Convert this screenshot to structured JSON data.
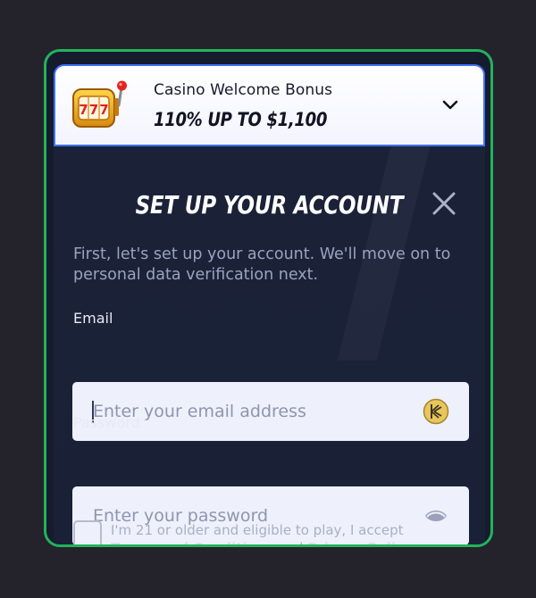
{
  "bonus": {
    "subtitle": "Casino Welcome Bonus",
    "title": "110% UP TO $1,100",
    "icon": "slot-machine-icon"
  },
  "modal": {
    "title": "SET UP YOUR ACCOUNT",
    "intro": "First, let's set up your account. We'll move on to personal data verification next."
  },
  "form": {
    "email": {
      "label": "Email",
      "placeholder": "Enter your email address",
      "icon": "password-manager-icon"
    },
    "password": {
      "label": "Password",
      "placeholder": "Enter your password",
      "icon": "eye-icon"
    },
    "consent": {
      "prefix": "I'm 21 or older and eligible to play, I accept ",
      "terms_link": "Terms and Conditions",
      "and_text": " and ",
      "privacy_link": "Privacy Policy",
      "suffix": ", and"
    }
  },
  "colors": {
    "frame": "#21b35c",
    "bonus_border": "#3e73ff",
    "panel_bg": "#1b2238",
    "page_bg": "#24232c"
  }
}
